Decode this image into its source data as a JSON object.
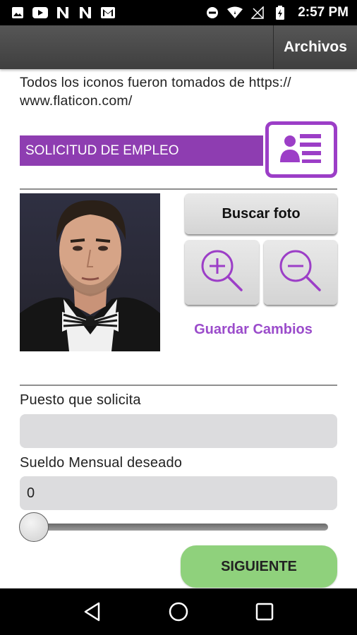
{
  "status_bar": {
    "time": "2:57 PM",
    "left_icons": [
      "image-icon",
      "youtube-icon",
      "notification-n-icon",
      "notification-n-icon",
      "gmail-icon"
    ],
    "right_icons": [
      "do-not-disturb-icon",
      "wifi-icon",
      "no-signal-icon",
      "battery-icon"
    ]
  },
  "app_bar": {
    "menu_label": "Archivos"
  },
  "credits_text": "Todos los iconos fueron tomados de https:// www.flaticon.com/",
  "section": {
    "title": "SOLICITUD DE EMPLEO",
    "accent_color": "#8e3db1",
    "icon": "id-card-icon"
  },
  "photo": {
    "description_icon": "profile-photo"
  },
  "buttons": {
    "search_photo": "Buscar foto",
    "zoom_in_icon": "zoom-in-icon",
    "zoom_out_icon": "zoom-out-icon",
    "save_changes": "Guardar Cambios",
    "next": "SIGUIENTE"
  },
  "form": {
    "position_label": "Puesto que solicita",
    "position_value": "",
    "salary_label": "Sueldo Mensual deseado",
    "salary_value": "0",
    "salary_slider_value": 0
  },
  "nav_bar": {
    "icons": [
      "back-icon",
      "home-icon",
      "recents-icon"
    ]
  },
  "colors": {
    "purple": "#9c3ec7",
    "green_button": "#8fd17c",
    "field_bg": "#dcdcde"
  }
}
